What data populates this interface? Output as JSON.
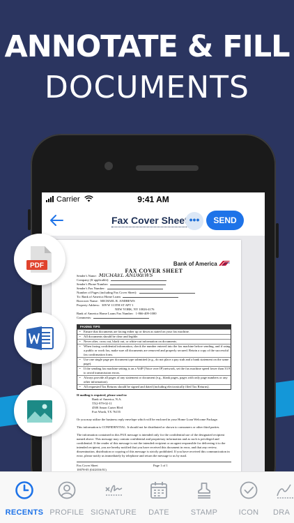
{
  "hero": {
    "line1": "ANNOTATE & FILL",
    "line2": "DOCUMENTS"
  },
  "status_bar": {
    "carrier": "Carrier",
    "time": "9:41 AM"
  },
  "nav": {
    "title": "Fax Cover Sheet",
    "more_label": "•••",
    "send_label": "SEND"
  },
  "document": {
    "bank": "Bank of America",
    "heading": "FAX COVER SHEET",
    "fields": [
      {
        "label": "Sender's Name:",
        "value": "MICHAEL ANDREWS"
      },
      {
        "label": "Company (If applicable):",
        "value": ""
      },
      {
        "label": "Sender's Phone Number:",
        "value": ""
      },
      {
        "label": "Sender's Fax Number:",
        "value": ""
      },
      {
        "label": "Number of Pages (including Fax Cover Sheet):",
        "value": ""
      },
      {
        "label": "To: Bank of America Home Loans",
        "value": ""
      },
      {
        "label": "Borrower Name:",
        "value": "MICHAEL R. ANDREWS"
      },
      {
        "label": "Property Address:",
        "value": "309 W 113TH ST APT 1"
      },
      {
        "label": "",
        "value": "NEW YORK, NY 10026-4176"
      },
      {
        "label": "Bank of America Home Loans Fax Number:",
        "value": "1-866-409-1000"
      },
      {
        "label": "Comments:",
        "value": ""
      }
    ],
    "tips_title": "FAXING TIPS",
    "tips": [
      "Ensure that documents are facing either up or down as stated on your fax machine.",
      "All documents should be clear and legible.",
      "Never alter, cross out, black out, or white-out information on documents.",
      "When faxing confidential information, check the number entered into the fax machine before sending, and if using a public or work fax, make sure all documents are removed and properly secured. Retain a copy of the successful fax confirmation form.",
      "Use one single page per document type submitted (e.g., do not place a pay stub and a bank statement on the same page).",
      "If the sending fax machine setting is on a VoIP (Voice over IP) network, set the fax machine speed lower than 33.9 to avoid transmission errors.",
      "Always provide all pages of any statement or document (e.g., blank pages, pages with only page numbers or any other information).",
      "All requested Tax Returns should be signed and dated (including electronically filed Tax Returns)."
    ],
    "mail_title": "If mailing is required, please send to:",
    "mail_lines": [
      "Bank of America, N.A.",
      "TX2-979-02-11",
      "4500 Amon Carter Blvd",
      "Fort Worth, TX 76155"
    ],
    "note1": "Or you may utilize the business reply envelope which will be enclosed in your Home Loan Welcome Package.",
    "note2": "This information is CONFIDENTIAL. It should not be distributed or shown to consumers or other third parties.",
    "note3": "The information contained in this FAX message is intended only for the confidential use of the designated recipient named above. This message may contain confidential and proprietary information and as such is privileged and confidential. If the reader of this message is not the intended recipient or an agent responsible for delivering it to the intended recipient, you are hereby notified that you have received this document in error, and that any review, dissemination, distribution or copying of this message is strictly prohibited. If you have received this communication in error, please notify us immediately by telephone and return the message to us by mail.",
    "footer_left": "Fax Cover Sheet",
    "footer_code": "10078-05 (04/2016/01)",
    "footer_page": "Page 1 of 1"
  },
  "side_buttons": {
    "pdf_label": "PDF"
  },
  "tabs": [
    {
      "label": "RECENTS",
      "icon": "clock-icon",
      "active": true
    },
    {
      "label": "PROFILE",
      "icon": "user-icon",
      "active": false
    },
    {
      "label": "SIGNATURE",
      "icon": "signature-icon",
      "active": false
    },
    {
      "label": "DATE",
      "icon": "calendar-icon",
      "active": false
    },
    {
      "label": "STAMP",
      "icon": "stamp-icon",
      "active": false
    },
    {
      "label": "ICON",
      "icon": "check-circle-icon",
      "active": false
    },
    {
      "label": "DRA",
      "icon": "draw-icon",
      "active": false
    }
  ],
  "colors": {
    "background": "#2b3560",
    "accent": "#1e73e8",
    "stripe": "#1497d8"
  }
}
